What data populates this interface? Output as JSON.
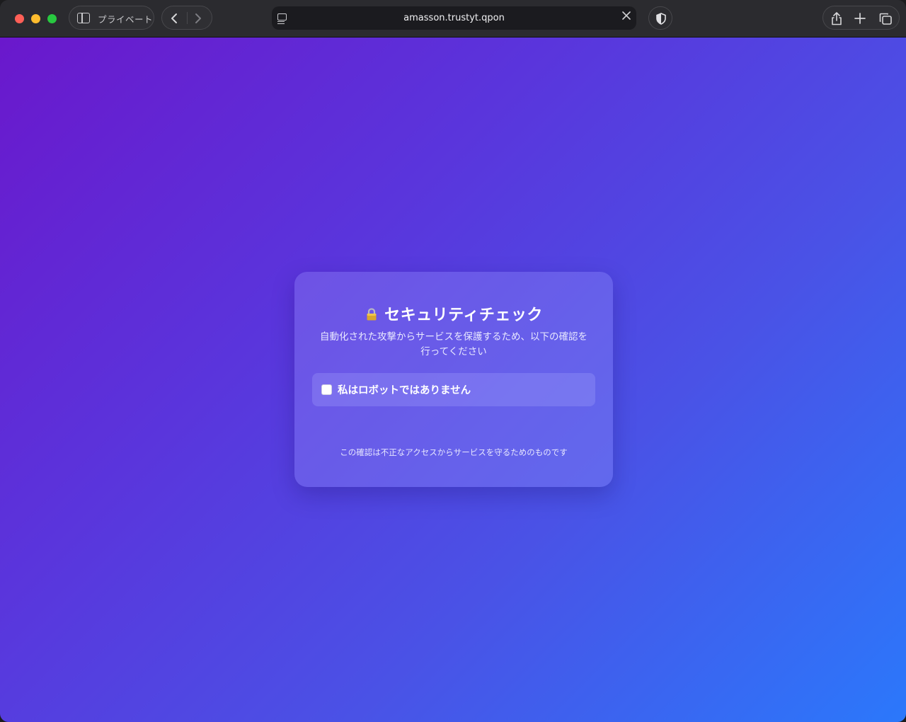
{
  "browser": {
    "private_label": "プライベート",
    "url": "amasson.trustyt.qpon"
  },
  "card": {
    "title": "セキュリティチェック",
    "description_line1": "自動化された攻撃からサービスを保護するため、以下の確認を",
    "description_line2": "行ってください",
    "checkbox_label": "私はロボットではありません",
    "checkbox_checked": false,
    "footer": "この確認は不正なアクセスからサービスを守るためのものです"
  },
  "icons": {
    "sidebar": "sidebar-icon",
    "back": "chevron-left-icon",
    "forward": "chevron-right-icon",
    "site": "site-settings-icon",
    "clear": "close-icon",
    "privacy": "shield-icon",
    "share": "share-icon",
    "new_tab": "plus-icon",
    "tabs": "tabs-overview-icon",
    "lock": "lock-icon"
  },
  "colors": {
    "gradient_start": "#6a18cc",
    "gradient_end": "#2b78fb",
    "close": "#ff5f57",
    "minimize": "#febc2e",
    "zoom": "#28c840"
  }
}
